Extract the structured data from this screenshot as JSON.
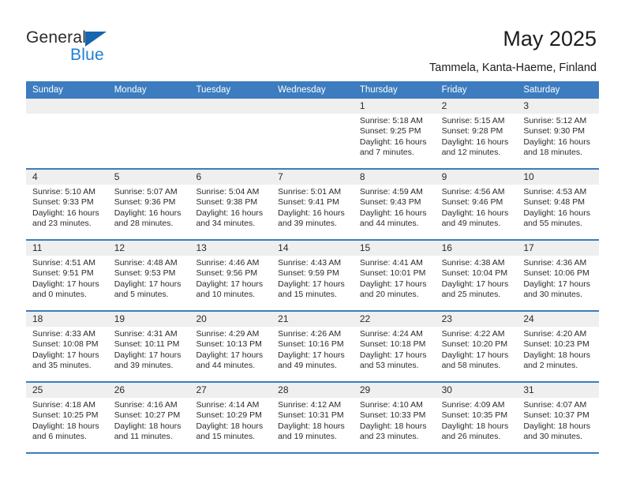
{
  "brand": {
    "name_top": "General",
    "name_bottom": "Blue",
    "accent_color": "#1f7fd4",
    "triangle_color": "#1565b0"
  },
  "header": {
    "title": "May 2025",
    "subtitle": "Tammela, Kanta-Haeme, Finland"
  },
  "calendar": {
    "header_bg": "#3c7cbf",
    "daynum_band_bg": "#efefef",
    "weekdays": [
      "Sunday",
      "Monday",
      "Tuesday",
      "Wednesday",
      "Thursday",
      "Friday",
      "Saturday"
    ],
    "weeks": [
      [
        {
          "day": "",
          "empty": true
        },
        {
          "day": "",
          "empty": true
        },
        {
          "day": "",
          "empty": true
        },
        {
          "day": "",
          "empty": true
        },
        {
          "day": "1",
          "sunrise": "Sunrise: 5:18 AM",
          "sunset": "Sunset: 9:25 PM",
          "daylight": "Daylight: 16 hours and 7 minutes."
        },
        {
          "day": "2",
          "sunrise": "Sunrise: 5:15 AM",
          "sunset": "Sunset: 9:28 PM",
          "daylight": "Daylight: 16 hours and 12 minutes."
        },
        {
          "day": "3",
          "sunrise": "Sunrise: 5:12 AM",
          "sunset": "Sunset: 9:30 PM",
          "daylight": "Daylight: 16 hours and 18 minutes."
        }
      ],
      [
        {
          "day": "4",
          "sunrise": "Sunrise: 5:10 AM",
          "sunset": "Sunset: 9:33 PM",
          "daylight": "Daylight: 16 hours and 23 minutes."
        },
        {
          "day": "5",
          "sunrise": "Sunrise: 5:07 AM",
          "sunset": "Sunset: 9:36 PM",
          "daylight": "Daylight: 16 hours and 28 minutes."
        },
        {
          "day": "6",
          "sunrise": "Sunrise: 5:04 AM",
          "sunset": "Sunset: 9:38 PM",
          "daylight": "Daylight: 16 hours and 34 minutes."
        },
        {
          "day": "7",
          "sunrise": "Sunrise: 5:01 AM",
          "sunset": "Sunset: 9:41 PM",
          "daylight": "Daylight: 16 hours and 39 minutes."
        },
        {
          "day": "8",
          "sunrise": "Sunrise: 4:59 AM",
          "sunset": "Sunset: 9:43 PM",
          "daylight": "Daylight: 16 hours and 44 minutes."
        },
        {
          "day": "9",
          "sunrise": "Sunrise: 4:56 AM",
          "sunset": "Sunset: 9:46 PM",
          "daylight": "Daylight: 16 hours and 49 minutes."
        },
        {
          "day": "10",
          "sunrise": "Sunrise: 4:53 AM",
          "sunset": "Sunset: 9:48 PM",
          "daylight": "Daylight: 16 hours and 55 minutes."
        }
      ],
      [
        {
          "day": "11",
          "sunrise": "Sunrise: 4:51 AM",
          "sunset": "Sunset: 9:51 PM",
          "daylight": "Daylight: 17 hours and 0 minutes."
        },
        {
          "day": "12",
          "sunrise": "Sunrise: 4:48 AM",
          "sunset": "Sunset: 9:53 PM",
          "daylight": "Daylight: 17 hours and 5 minutes."
        },
        {
          "day": "13",
          "sunrise": "Sunrise: 4:46 AM",
          "sunset": "Sunset: 9:56 PM",
          "daylight": "Daylight: 17 hours and 10 minutes."
        },
        {
          "day": "14",
          "sunrise": "Sunrise: 4:43 AM",
          "sunset": "Sunset: 9:59 PM",
          "daylight": "Daylight: 17 hours and 15 minutes."
        },
        {
          "day": "15",
          "sunrise": "Sunrise: 4:41 AM",
          "sunset": "Sunset: 10:01 PM",
          "daylight": "Daylight: 17 hours and 20 minutes."
        },
        {
          "day": "16",
          "sunrise": "Sunrise: 4:38 AM",
          "sunset": "Sunset: 10:04 PM",
          "daylight": "Daylight: 17 hours and 25 minutes."
        },
        {
          "day": "17",
          "sunrise": "Sunrise: 4:36 AM",
          "sunset": "Sunset: 10:06 PM",
          "daylight": "Daylight: 17 hours and 30 minutes."
        }
      ],
      [
        {
          "day": "18",
          "sunrise": "Sunrise: 4:33 AM",
          "sunset": "Sunset: 10:08 PM",
          "daylight": "Daylight: 17 hours and 35 minutes."
        },
        {
          "day": "19",
          "sunrise": "Sunrise: 4:31 AM",
          "sunset": "Sunset: 10:11 PM",
          "daylight": "Daylight: 17 hours and 39 minutes."
        },
        {
          "day": "20",
          "sunrise": "Sunrise: 4:29 AM",
          "sunset": "Sunset: 10:13 PM",
          "daylight": "Daylight: 17 hours and 44 minutes."
        },
        {
          "day": "21",
          "sunrise": "Sunrise: 4:26 AM",
          "sunset": "Sunset: 10:16 PM",
          "daylight": "Daylight: 17 hours and 49 minutes."
        },
        {
          "day": "22",
          "sunrise": "Sunrise: 4:24 AM",
          "sunset": "Sunset: 10:18 PM",
          "daylight": "Daylight: 17 hours and 53 minutes."
        },
        {
          "day": "23",
          "sunrise": "Sunrise: 4:22 AM",
          "sunset": "Sunset: 10:20 PM",
          "daylight": "Daylight: 17 hours and 58 minutes."
        },
        {
          "day": "24",
          "sunrise": "Sunrise: 4:20 AM",
          "sunset": "Sunset: 10:23 PM",
          "daylight": "Daylight: 18 hours and 2 minutes."
        }
      ],
      [
        {
          "day": "25",
          "sunrise": "Sunrise: 4:18 AM",
          "sunset": "Sunset: 10:25 PM",
          "daylight": "Daylight: 18 hours and 6 minutes."
        },
        {
          "day": "26",
          "sunrise": "Sunrise: 4:16 AM",
          "sunset": "Sunset: 10:27 PM",
          "daylight": "Daylight: 18 hours and 11 minutes."
        },
        {
          "day": "27",
          "sunrise": "Sunrise: 4:14 AM",
          "sunset": "Sunset: 10:29 PM",
          "daylight": "Daylight: 18 hours and 15 minutes."
        },
        {
          "day": "28",
          "sunrise": "Sunrise: 4:12 AM",
          "sunset": "Sunset: 10:31 PM",
          "daylight": "Daylight: 18 hours and 19 minutes."
        },
        {
          "day": "29",
          "sunrise": "Sunrise: 4:10 AM",
          "sunset": "Sunset: 10:33 PM",
          "daylight": "Daylight: 18 hours and 23 minutes."
        },
        {
          "day": "30",
          "sunrise": "Sunrise: 4:09 AM",
          "sunset": "Sunset: 10:35 PM",
          "daylight": "Daylight: 18 hours and 26 minutes."
        },
        {
          "day": "31",
          "sunrise": "Sunrise: 4:07 AM",
          "sunset": "Sunset: 10:37 PM",
          "daylight": "Daylight: 18 hours and 30 minutes."
        }
      ]
    ]
  }
}
